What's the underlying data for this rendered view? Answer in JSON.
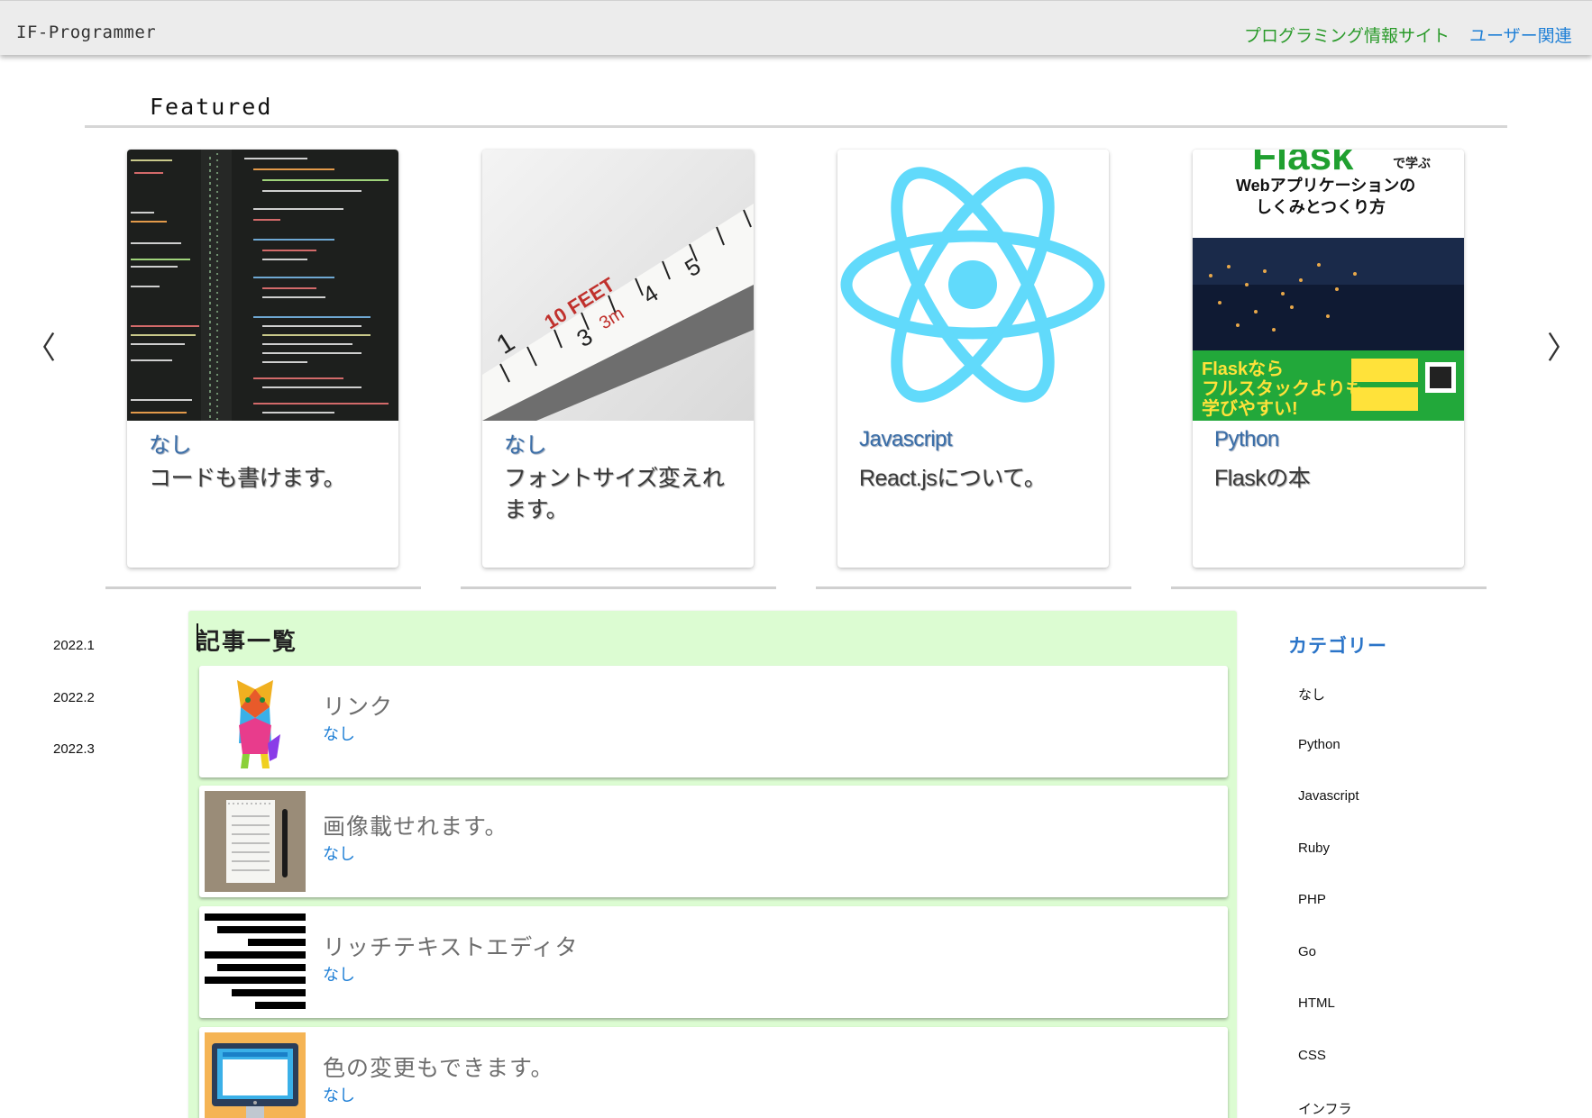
{
  "header": {
    "brand": "IF-Programmer",
    "nav": [
      "プログラミング情報サイト",
      "ユーザー関連"
    ]
  },
  "featured": {
    "title": "Featured",
    "prev_arrow": "〈",
    "next_arrow": "〉",
    "cards": [
      {
        "category": "なし",
        "title": "コードも書けます。",
        "image": "code-screenshot"
      },
      {
        "category": "なし",
        "title": "フォントサイズ変えれます。",
        "image": "tape-measure"
      },
      {
        "category": "Javascript",
        "title": "React.jsについて。",
        "image": "react-logo"
      },
      {
        "category": "Python",
        "title": "Flaskの本",
        "image": "flask-book-cover",
        "cover_text": {
          "headline": "Flask",
          "subtitle_1": "で学ぶ",
          "subtitle_2": "Webアプリケーションの",
          "subtitle_3": "しくみとつくり方",
          "band_1": "Flaskなら",
          "band_2": "フルスタックよりも",
          "band_3": "学びやすい!"
        }
      }
    ]
  },
  "archive": [
    "2022.1",
    "2022.2",
    "2022.3"
  ],
  "articles": {
    "heading": "記事一覧",
    "items": [
      {
        "title": "リンク",
        "category": "なし",
        "thumb": "colorful-cat"
      },
      {
        "title": "画像載せれます。",
        "category": "なし",
        "thumb": "notepad-pen"
      },
      {
        "title": "リッチテキストエディタ",
        "category": "なし",
        "thumb": "text-align-icon"
      },
      {
        "title": "色の変更もできます。",
        "category": "なし",
        "thumb": "monitor-icon"
      }
    ]
  },
  "categories": {
    "heading": "カテゴリー",
    "items": [
      "なし",
      "Python",
      "Javascript",
      "Ruby",
      "PHP",
      "Go",
      "HTML",
      "CSS",
      "インフラ"
    ]
  },
  "colors": {
    "header_bg": "#ececec",
    "nav_green": "#2a9a2a",
    "nav_blue": "#1e7fd6",
    "list_bg": "#dcfcd2",
    "react_blue": "#61dafb"
  }
}
